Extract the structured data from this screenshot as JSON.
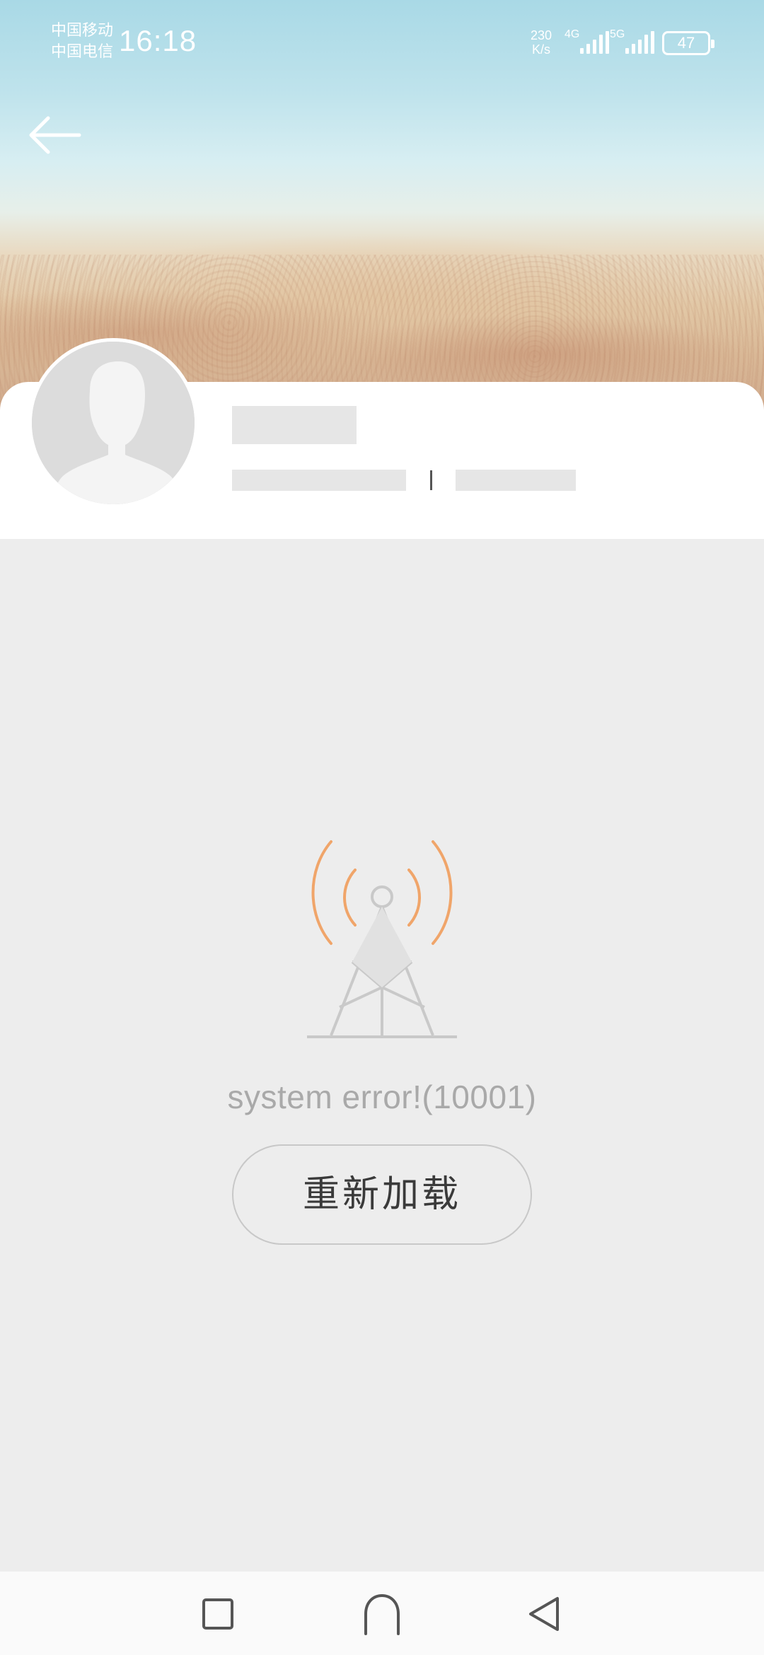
{
  "status_bar": {
    "carrier_1": "中国移动",
    "carrier_2": "中国电信",
    "time": "16:18",
    "net_speed_value": "230",
    "net_speed_unit": "K/s",
    "sim1_network": "4G",
    "sim2_network": "5G",
    "battery": "47"
  },
  "error": {
    "message": "system error!(10001)",
    "reload_label": "重新加载"
  },
  "colors": {
    "accent_signal": "#f0a56a",
    "tower": "#c9c9c9",
    "background": "#ededed"
  },
  "icons": {
    "back": "arrow-left-icon",
    "tower": "signal-tower-icon",
    "avatar": "default-avatar-icon",
    "recents": "square-icon",
    "home": "home-arch-icon",
    "back_nav": "triangle-back-icon"
  }
}
